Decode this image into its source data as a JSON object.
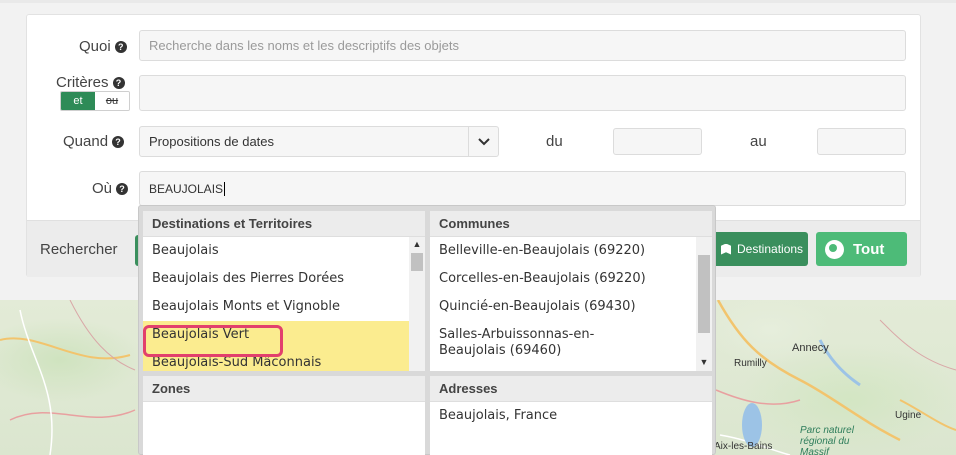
{
  "form": {
    "quoi_label": "Quoi",
    "quoi_placeholder": "Recherche dans les noms et les descriptifs des objets",
    "criteres_label": "Critères",
    "toggle_on": "et",
    "toggle_off": "ou",
    "quand_label": "Quand",
    "quand_select": "Propositions de dates",
    "du_label": "du",
    "au_label": "au",
    "ou_label": "Où",
    "ou_value": "BEAUJOLAIS",
    "help_glyph": "?"
  },
  "bottombar": {
    "rechercher_label": "Rechercher",
    "destinations_label": "Destinations",
    "tout_label": "Tout"
  },
  "dropdown": {
    "destinations": {
      "header": "Destinations et Territoires",
      "items": [
        "Beaujolais",
        "Beaujolais des Pierres Dorées",
        "Beaujolais Monts et Vignoble",
        "Beaujolais Vert",
        "Beaujolais-Sud Mâconnais"
      ],
      "highlighted_indices": [
        3,
        4
      ]
    },
    "communes": {
      "header": "Communes",
      "items": [
        "Belleville-en-Beaujolais (69220)",
        "Corcelles-en-Beaujolais (69220)",
        "Quincié-en-Beaujolais (69430)",
        "Salles-Arbuissonnas-en-Beaujolais (69460)"
      ]
    },
    "zones": {
      "header": "Zones",
      "items": []
    },
    "adresses": {
      "header": "Adresses",
      "items": [
        "Beaujolais, France"
      ]
    }
  },
  "map": {
    "labels": [
      "Annecy",
      "Rumilly",
      "Ugine",
      "Aix-les-Bains",
      "Parc naturel régional du Massif"
    ]
  },
  "colors": {
    "green_dark": "#3a8f5d",
    "green_light": "#4dbb78",
    "highlight": "#fbec8f",
    "focus": "#e2406d"
  }
}
